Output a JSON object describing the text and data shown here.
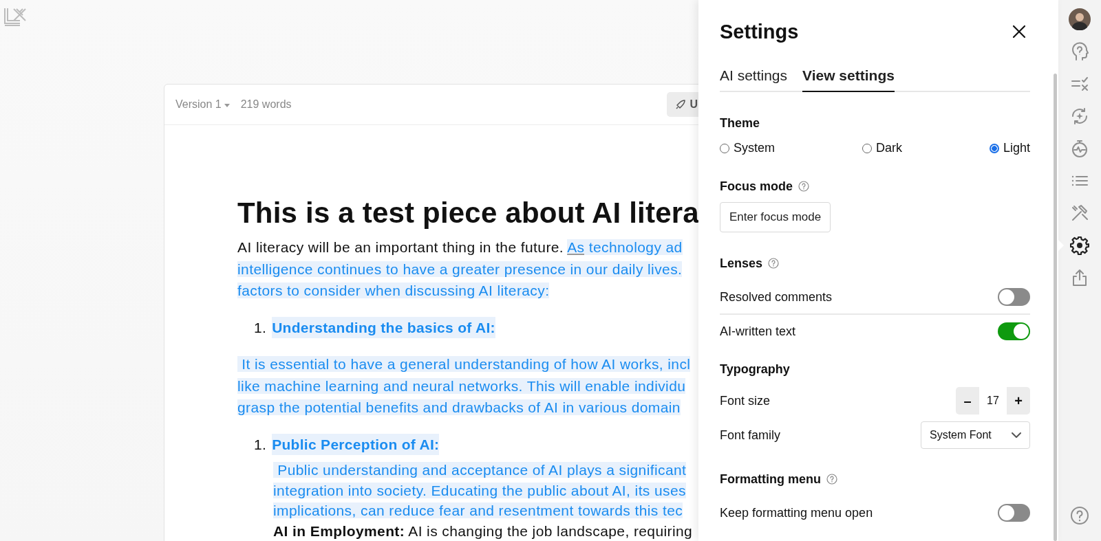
{
  "document": {
    "version": "Version 1",
    "word_count": "219 words",
    "toolbar_button": "U",
    "title": "This is a test piece about AI litera",
    "blocks": [
      {
        "kind": "paragraph",
        "indented": false,
        "lines": [
          [
            {
              "text": "AI literacy will be an important thing in the future. ",
              "ai": false
            },
            {
              "text": "As",
              "ai": true,
              "underlined": true
            },
            {
              "text": " technology ad",
              "ai": true
            }
          ],
          [
            {
              "text": "intelligence continues to have a greater presence in our daily lives.",
              "ai": true
            }
          ],
          [
            {
              "text": "factors to consider when discussing AI literacy:",
              "ai": true
            }
          ]
        ]
      },
      {
        "kind": "list_item",
        "number": "1.",
        "text": "Understanding the basics of AI:"
      },
      {
        "kind": "paragraph",
        "indented": false,
        "lines": [
          [
            {
              "text": " It is essential to have a general understanding of how AI works, incl",
              "ai": true
            }
          ],
          [
            {
              "text": "like machine learning and neural networks. This will enable individu",
              "ai": true
            }
          ],
          [
            {
              "text": "grasp the potential benefits and drawbacks of AI in various domain",
              "ai": true
            }
          ]
        ]
      },
      {
        "kind": "list_item",
        "number": "1.",
        "text": "Public Perception of AI:"
      },
      {
        "kind": "paragraph",
        "indented": true,
        "lines": [
          [
            {
              "text": " Public understanding and acceptance of AI plays a significant",
              "ai": true
            }
          ],
          [
            {
              "text": "integration into society. Educating the public about AI, its uses",
              "ai": true
            }
          ],
          [
            {
              "text": "implications, can reduce fear and resentment towards this tec",
              "ai": true
            }
          ],
          [
            {
              "text": "**AI in Employment:** AI is changing the job landscape, requiring",
              "ai": false
            }
          ]
        ]
      }
    ]
  },
  "settings": {
    "title": "Settings",
    "tabs": [
      {
        "label": "AI settings",
        "selected": false
      },
      {
        "label": "View settings",
        "selected": true
      }
    ],
    "sections": [
      {
        "kind": "radio",
        "heading": "Theme",
        "help": false,
        "options": [
          {
            "label": "System",
            "selected": false
          },
          {
            "label": "Dark",
            "selected": false
          },
          {
            "label": "Light",
            "selected": true
          }
        ]
      },
      {
        "kind": "button",
        "heading": "Focus mode",
        "help": true,
        "button": "Enter focus mode"
      },
      {
        "kind": "toggles",
        "heading": "Lenses",
        "help": true,
        "items": [
          {
            "label": "Resolved comments",
            "on": false
          },
          {
            "label": "AI-written text",
            "on": true
          }
        ]
      },
      {
        "kind": "controls",
        "heading": "Typography",
        "help": false,
        "items": [
          {
            "kind": "stepper",
            "label": "Font size",
            "value": "17",
            "minus": "–",
            "plus": "+"
          },
          {
            "kind": "select",
            "label": "Font family",
            "value": "System Font"
          }
        ]
      },
      {
        "kind": "toggles",
        "heading": "Formatting menu",
        "help": true,
        "items": [
          {
            "label": "Keep formatting menu open",
            "on": false
          }
        ]
      }
    ]
  },
  "rail": {
    "items": [
      {
        "kind": "avatar",
        "selected": false
      },
      {
        "kind": "help-head",
        "selected": false
      },
      {
        "kind": "checklist",
        "selected": false
      },
      {
        "kind": "sparkle",
        "selected": false
      },
      {
        "kind": "stopwatch",
        "selected": false
      },
      {
        "kind": "list",
        "selected": false
      },
      {
        "kind": "tools",
        "selected": false
      },
      {
        "kind": "gear",
        "selected": true
      },
      {
        "kind": "share",
        "selected": false
      }
    ],
    "bottom": [
      {
        "kind": "help",
        "selected": false
      }
    ]
  }
}
